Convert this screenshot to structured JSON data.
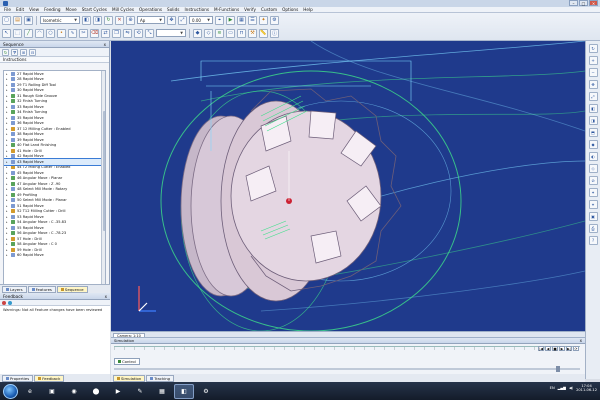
{
  "window": {
    "title": "",
    "controls": [
      "–",
      "□",
      "×"
    ]
  },
  "menu": [
    "File",
    "Edit",
    "View",
    "Feeding",
    "Move",
    "Start Cycles",
    "Mill Cycles",
    "Operations",
    "Solids",
    "Instructions",
    "M-Functions",
    "Verify",
    "Custom",
    "Options",
    "Help"
  ],
  "toolbar": {
    "combo1": "Isometric",
    "combo2": "Ap",
    "combo3": "0.00",
    "combo4": ""
  },
  "left_panel": {
    "title": "Sequence",
    "close": "x",
    "instructions_header": "Instructions",
    "items": [
      {
        "label": "27 Rapid Move",
        "icon": "instr"
      },
      {
        "label": "28 Rapid Move",
        "icon": "instr"
      },
      {
        "label": "29 T1 Rolling Diff Tool",
        "icon": "instr"
      },
      {
        "label": "30 Rapid Move",
        "icon": "instr"
      },
      {
        "label": "31 Rough Side Groove",
        "icon": "move"
      },
      {
        "label": "32 Finish Turning",
        "icon": "move"
      },
      {
        "label": "33 Rapid Move",
        "icon": "instr"
      },
      {
        "label": "34 Finish Turning",
        "icon": "move"
      },
      {
        "label": "35 Rapid Move",
        "icon": "instr"
      },
      {
        "label": "36 Rapid Move",
        "icon": "instr"
      },
      {
        "label": "37 12 Milling Cutter : Enabled",
        "icon": "drill"
      },
      {
        "label": "38 Rapid Move",
        "icon": "instr"
      },
      {
        "label": "39 Rapid Move",
        "icon": "instr"
      },
      {
        "label": "40 Flat Land Finishing",
        "icon": "move"
      },
      {
        "label": "41 Hole : Drill",
        "icon": "drill"
      },
      {
        "label": "42 Rapid Move",
        "icon": "instr"
      },
      {
        "label": "43 Rapid Move",
        "icon": "instr",
        "selected": true
      },
      {
        "label": "44 T2 Milling Cutter : Enabled",
        "icon": "drill"
      },
      {
        "label": "45 Rapid Move",
        "icon": "instr"
      },
      {
        "label": "46 Angular Move : Planar",
        "icon": "move"
      },
      {
        "label": "47 Angular Move : Z -90",
        "icon": "move"
      },
      {
        "label": "48 Select Mill Mode : Rotary",
        "icon": "instr"
      },
      {
        "label": "49 Profiling",
        "icon": "move"
      },
      {
        "label": "50 Select Mill Mode : Planar",
        "icon": "instr"
      },
      {
        "label": "51 Rapid Move",
        "icon": "instr"
      },
      {
        "label": "52 T12 Milling Cutter : Drill",
        "icon": "drill"
      },
      {
        "label": "53 Rapid Move",
        "icon": "instr"
      },
      {
        "label": "54 Angular Move : C -35.83",
        "icon": "move"
      },
      {
        "label": "55 Rapid Move",
        "icon": "instr"
      },
      {
        "label": "56 Angular Move : C -78.23",
        "icon": "move"
      },
      {
        "label": "57 Hole : Drill",
        "icon": "drill"
      },
      {
        "label": "58 Angular Move : C 0",
        "icon": "move"
      },
      {
        "label": "59 Hole : Drill",
        "icon": "drill"
      },
      {
        "label": "60 Rapid Move",
        "icon": "instr"
      }
    ],
    "tabs": [
      "Layers",
      "Features",
      "Sequence"
    ]
  },
  "feedback": {
    "title": "Feedback",
    "close": "x",
    "message": "Warnings: Not all Feature changes have been reviewed"
  },
  "left_tabs_bottom": [
    "Properties",
    "Feedback"
  ],
  "viewport": {
    "tab": "Camera: 1:10",
    "background": "#1f3a8c",
    "part_color": "#d9c8d6",
    "toolpath_color_green": "#3de08a",
    "toolpath_color_cyan": "#7fd8ff"
  },
  "simulation": {
    "title": "Simulation",
    "close": "x",
    "controls": [
      "|◀",
      "◀",
      "■",
      "▶",
      "▶|",
      "⟳"
    ],
    "toggle": "Control"
  },
  "sim_tabs": [
    "Simulation",
    "Tracking"
  ],
  "taskbar": {
    "apps": [
      "e",
      "▣",
      "◉",
      "⬤",
      "▶",
      "✎",
      "▦",
      "◧",
      "⚙"
    ],
    "tray_text": "EN",
    "time": "17:04",
    "date": "2011-06-12"
  }
}
